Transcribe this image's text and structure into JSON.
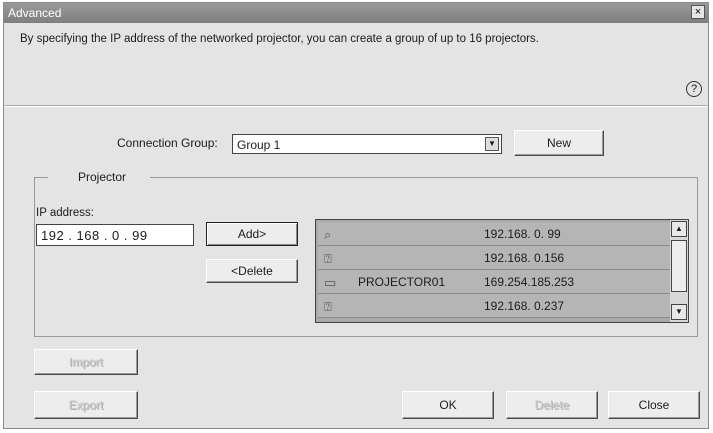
{
  "window": {
    "title": "Advanced",
    "close_glyph": "×"
  },
  "description": "By specifying the IP address of the networked projector, you can create a group of up to 16 projectors.",
  "help_glyph": "?",
  "connection_group": {
    "label": "Connection Group:",
    "value": "Group 1",
    "new_label": "New"
  },
  "projector": {
    "group_label": "Projector",
    "ip_label": "IP address:",
    "ip_value": "192 . 168 .  0  .  99",
    "add_label": "Add>",
    "delete_label": "<Delete",
    "rows": [
      {
        "icon": "projector-search-icon",
        "glyph": "⌕",
        "name": "",
        "ip": "192.168.  0. 99"
      },
      {
        "icon": "projector-unknown-icon",
        "glyph": "⍰",
        "name": "",
        "ip": "192.168.  0.156"
      },
      {
        "icon": "projector-icon",
        "glyph": "▭",
        "name": "PROJECTOR01",
        "ip": "169.254.185.253"
      },
      {
        "icon": "projector-unknown-icon",
        "glyph": "⍰",
        "name": "",
        "ip": "192.168.  0.237"
      }
    ]
  },
  "buttons": {
    "import": "Import",
    "export": "Export",
    "ok": "OK",
    "delete": "Delete",
    "close": "Close"
  }
}
